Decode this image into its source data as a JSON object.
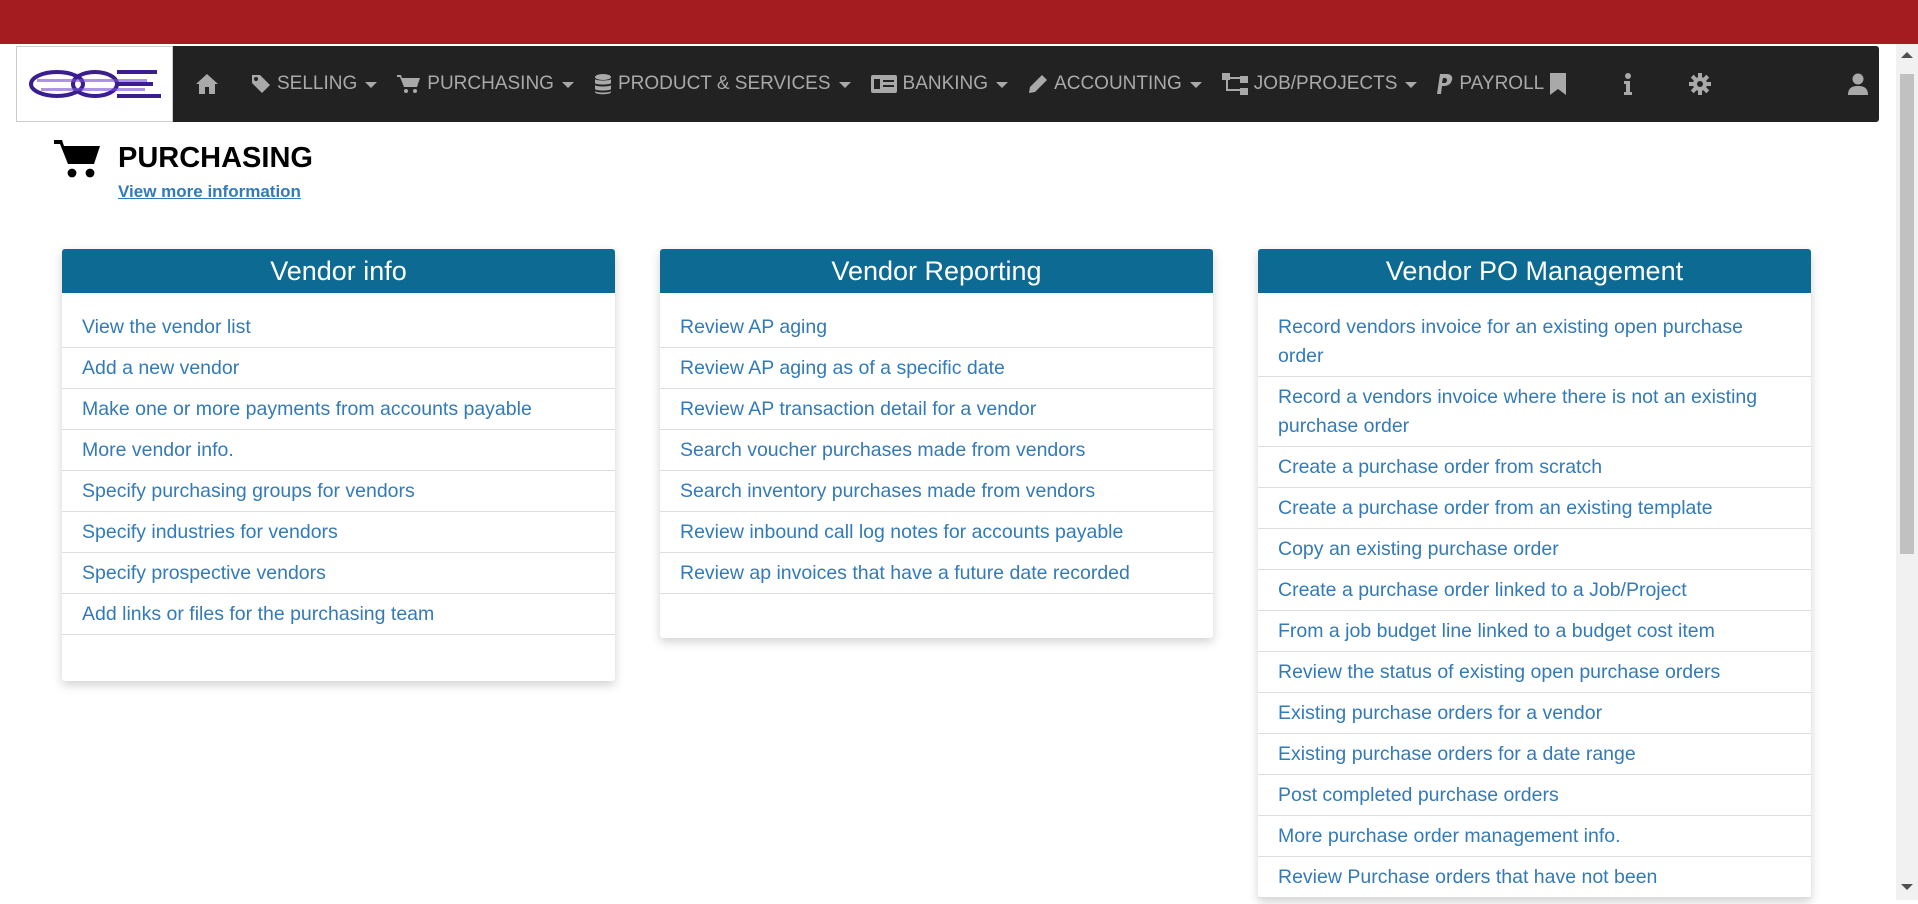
{
  "nav": {
    "logo_alt": "Company logo",
    "items": [
      {
        "label": "SELLING",
        "icon": "tag-icon"
      },
      {
        "label": "PURCHASING",
        "icon": "cart-icon"
      },
      {
        "label": "PRODUCT & SERVICES",
        "icon": "database-icon"
      },
      {
        "label": "BANKING",
        "icon": "money-icon"
      },
      {
        "label": "ACCOUNTING",
        "icon": "pencil-icon"
      },
      {
        "label": "JOB/PROJECTS",
        "icon": "sitemap-icon"
      },
      {
        "label": "PAYROLL",
        "icon": "paypal-icon"
      }
    ],
    "right_icons": [
      "bookmark-icon",
      "info-icon",
      "gear-icon",
      "user-icon"
    ]
  },
  "page": {
    "title": "PURCHASING",
    "link": "View more information"
  },
  "panels": [
    {
      "title": "Vendor info",
      "items": [
        "View the vendor list",
        "Add a new vendor",
        "Make one or more payments from accounts payable",
        "More vendor info.",
        "Specify purchasing groups for vendors",
        "Specify industries for vendors",
        "Specify prospective vendors",
        "Add links or files for the purchasing team"
      ]
    },
    {
      "title": "Vendor Reporting",
      "items": [
        "Review AP aging",
        "Review AP aging as of a specific date",
        "Review AP transaction detail for a vendor",
        "Search voucher purchases made from vendors",
        "Search inventory purchases made from vendors",
        "Review inbound call log notes for accounts payable",
        "Review ap invoices that have a future date recorded"
      ]
    },
    {
      "title": "Vendor PO Management",
      "items": [
        "Record vendors invoice for an existing open purchase order",
        "Record a vendors invoice where there is not an existing purchase order",
        "Create a purchase order from scratch",
        "Create a purchase order from an existing template",
        "Copy an existing purchase order",
        "Create a purchase order linked to a Job/Project",
        "From a job budget line linked to a budget cost item",
        "Review the status of existing open purchase orders",
        "Existing purchase orders for a vendor",
        "Existing purchase orders for a date range",
        "Post completed purchase orders",
        "More purchase order management info.",
        "Review Purchase orders that have not been"
      ]
    }
  ],
  "colors": {
    "top_bar": "#a51c20",
    "navbar": "#222222",
    "panel_header": "#0d6a92",
    "link": "#337ab7"
  }
}
